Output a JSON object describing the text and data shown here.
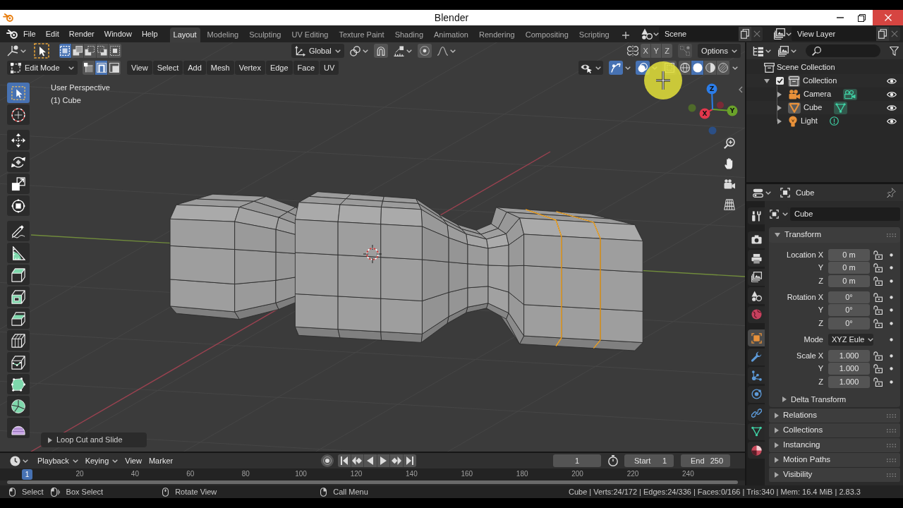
{
  "window": {
    "title": "Blender"
  },
  "menu": [
    "File",
    "Edit",
    "Render",
    "Window",
    "Help"
  ],
  "workspaces": [
    {
      "label": "Layout",
      "selected": true
    },
    {
      "label": "Modeling",
      "selected": false
    },
    {
      "label": "Sculpting",
      "selected": false
    },
    {
      "label": "UV Editing",
      "selected": false
    },
    {
      "label": "Texture Paint",
      "selected": false
    },
    {
      "label": "Shading",
      "selected": false
    },
    {
      "label": "Animation",
      "selected": false
    },
    {
      "label": "Rendering",
      "selected": false
    },
    {
      "label": "Compositing",
      "selected": false
    },
    {
      "label": "Scripting",
      "selected": false
    }
  ],
  "scene": {
    "value": "Scene"
  },
  "view_layer": {
    "value": "View Layer"
  },
  "viewport": {
    "tool_header": {
      "select_modes": [
        {
          "selected": true
        },
        {
          "selected": false
        },
        {
          "selected": false
        },
        {
          "selected": false
        },
        {
          "selected": false
        }
      ],
      "orientation": "Global",
      "mirror_axes": [
        {
          "label": "X",
          "on": false
        },
        {
          "label": "Y",
          "on": false
        },
        {
          "label": "Z",
          "on": false
        }
      ],
      "options": "Options"
    },
    "header": {
      "mode": "Edit Mode",
      "select_modes": [
        {
          "selected": false
        },
        {
          "selected": true
        },
        {
          "selected": false
        }
      ],
      "menus": [
        "View",
        "Select",
        "Add",
        "Mesh",
        "Vertex",
        "Edge",
        "Face",
        "UV"
      ],
      "toggles": [
        {
          "on": true
        },
        {
          "on": true
        },
        {
          "on": false
        }
      ],
      "shading": [
        {
          "selected": false
        },
        {
          "selected": true
        },
        {
          "selected": false
        },
        {
          "selected": false
        }
      ]
    },
    "view_name": "User Perspective",
    "object_label": "(1) Cube",
    "tools": [
      {
        "selected": true
      },
      {
        "selected": false
      },
      {
        "selected": false
      },
      {
        "selected": false
      },
      {
        "selected": false
      },
      {
        "selected": false
      },
      {
        "selected": false
      },
      {
        "selected": false
      },
      {
        "selected": false
      },
      {
        "selected": false
      },
      {
        "selected": false
      },
      {
        "selected": false
      },
      {
        "selected": false
      },
      {
        "selected": false
      },
      {
        "selected": false
      },
      {
        "selected": false
      }
    ],
    "gizmo": {
      "axes": [
        "X",
        "Y",
        "Z"
      ]
    },
    "last_operator": {
      "label": "Loop Cut and Slide",
      "expanded": false
    }
  },
  "timeline": {
    "menus": [
      {
        "label": "Playback",
        "kind": "dropdown"
      },
      {
        "label": "Keying",
        "kind": "dropdown"
      },
      {
        "label": "View",
        "kind": "menu"
      },
      {
        "label": "Marker",
        "kind": "menu"
      }
    ],
    "current_frame": "1",
    "start": {
      "label": "Start",
      "value": "1"
    },
    "end": {
      "label": "End",
      "value": "250"
    },
    "ruler": {
      "current": "1",
      "ticks": [
        "20",
        "40",
        "60",
        "80",
        "100",
        "120",
        "140",
        "160",
        "180",
        "200",
        "220",
        "240"
      ]
    }
  },
  "outliner": {
    "root": "Scene Collection",
    "items": [
      {
        "label": "Collection",
        "kind": "collection",
        "expanded": true,
        "checked": true,
        "selected": true,
        "visible": true,
        "children": [
          {
            "label": "Camera",
            "kind": "camera",
            "expanded": false,
            "selected": false,
            "visible": true
          },
          {
            "label": "Cube",
            "kind": "mesh",
            "expanded": false,
            "selected": true,
            "visible": true
          },
          {
            "label": "Light",
            "kind": "light",
            "expanded": false,
            "selected": false,
            "visible": true
          }
        ]
      }
    ]
  },
  "properties": {
    "title": "Cube",
    "tabs": [
      {
        "selected": false
      },
      {
        "selected": false
      },
      {
        "selected": false
      },
      {
        "selected": false
      },
      {
        "selected": false
      },
      {
        "selected": false
      },
      {
        "selected": true
      },
      {
        "selected": false
      },
      {
        "selected": false
      },
      {
        "selected": false
      },
      {
        "selected": false
      },
      {
        "selected": false
      },
      {
        "selected": false
      }
    ],
    "object_name": "Cube",
    "transform": {
      "title": "Transform",
      "expanded": true,
      "groups": [
        [
          {
            "label": "Location X",
            "value": "0 m",
            "kind": "number",
            "locked": false
          },
          {
            "label": "Y",
            "value": "0 m",
            "kind": "number",
            "locked": false
          },
          {
            "label": "Z",
            "value": "0 m",
            "kind": "number",
            "locked": false
          }
        ],
        [
          {
            "label": "Rotation X",
            "value": "0°",
            "kind": "number",
            "locked": false
          },
          {
            "label": "Y",
            "value": "0°",
            "kind": "number",
            "locked": false
          },
          {
            "label": "Z",
            "value": "0°",
            "kind": "number",
            "locked": false
          }
        ],
        [
          {
            "label": "Mode",
            "value": "XYZ Eule",
            "kind": "dropdown"
          }
        ],
        [
          {
            "label": "Scale X",
            "value": "1.000",
            "kind": "number",
            "locked": false
          },
          {
            "label": "Y",
            "value": "1.000",
            "kind": "number",
            "locked": false
          },
          {
            "label": "Z",
            "value": "1.000",
            "kind": "number",
            "locked": false
          }
        ]
      ],
      "subpanels": [
        {
          "label": "Delta Transform",
          "expanded": false
        }
      ]
    },
    "panels": [
      {
        "label": "Relations",
        "expanded": false
      },
      {
        "label": "Collections",
        "expanded": false
      },
      {
        "label": "Instancing",
        "expanded": false
      },
      {
        "label": "Motion Paths",
        "expanded": false
      },
      {
        "label": "Visibility",
        "expanded": false
      }
    ]
  },
  "status_bar": {
    "hints": [
      "Select",
      "Box Select",
      "Rotate View",
      "Call Menu"
    ],
    "stats": "Cube | Verts:24/172 | Edges:24/336 | Faces:0/166 | Tris:340 | Mem: 16.4 MiB | 2.83.3"
  }
}
